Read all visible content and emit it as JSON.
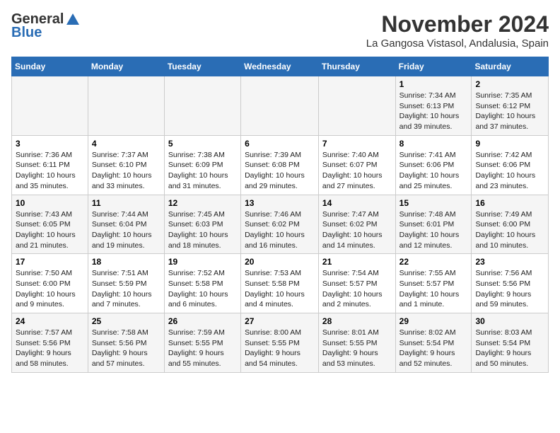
{
  "logo": {
    "general": "General",
    "blue": "Blue"
  },
  "title": "November 2024",
  "location": "La Gangosa Vistasol, Andalusia, Spain",
  "days_of_week": [
    "Sunday",
    "Monday",
    "Tuesday",
    "Wednesday",
    "Thursday",
    "Friday",
    "Saturday"
  ],
  "weeks": [
    [
      {
        "day": "",
        "info": ""
      },
      {
        "day": "",
        "info": ""
      },
      {
        "day": "",
        "info": ""
      },
      {
        "day": "",
        "info": ""
      },
      {
        "day": "",
        "info": ""
      },
      {
        "day": "1",
        "info": "Sunrise: 7:34 AM\nSunset: 6:13 PM\nDaylight: 10 hours and 39 minutes."
      },
      {
        "day": "2",
        "info": "Sunrise: 7:35 AM\nSunset: 6:12 PM\nDaylight: 10 hours and 37 minutes."
      }
    ],
    [
      {
        "day": "3",
        "info": "Sunrise: 7:36 AM\nSunset: 6:11 PM\nDaylight: 10 hours and 35 minutes."
      },
      {
        "day": "4",
        "info": "Sunrise: 7:37 AM\nSunset: 6:10 PM\nDaylight: 10 hours and 33 minutes."
      },
      {
        "day": "5",
        "info": "Sunrise: 7:38 AM\nSunset: 6:09 PM\nDaylight: 10 hours and 31 minutes."
      },
      {
        "day": "6",
        "info": "Sunrise: 7:39 AM\nSunset: 6:08 PM\nDaylight: 10 hours and 29 minutes."
      },
      {
        "day": "7",
        "info": "Sunrise: 7:40 AM\nSunset: 6:07 PM\nDaylight: 10 hours and 27 minutes."
      },
      {
        "day": "8",
        "info": "Sunrise: 7:41 AM\nSunset: 6:06 PM\nDaylight: 10 hours and 25 minutes."
      },
      {
        "day": "9",
        "info": "Sunrise: 7:42 AM\nSunset: 6:06 PM\nDaylight: 10 hours and 23 minutes."
      }
    ],
    [
      {
        "day": "10",
        "info": "Sunrise: 7:43 AM\nSunset: 6:05 PM\nDaylight: 10 hours and 21 minutes."
      },
      {
        "day": "11",
        "info": "Sunrise: 7:44 AM\nSunset: 6:04 PM\nDaylight: 10 hours and 19 minutes."
      },
      {
        "day": "12",
        "info": "Sunrise: 7:45 AM\nSunset: 6:03 PM\nDaylight: 10 hours and 18 minutes."
      },
      {
        "day": "13",
        "info": "Sunrise: 7:46 AM\nSunset: 6:02 PM\nDaylight: 10 hours and 16 minutes."
      },
      {
        "day": "14",
        "info": "Sunrise: 7:47 AM\nSunset: 6:02 PM\nDaylight: 10 hours and 14 minutes."
      },
      {
        "day": "15",
        "info": "Sunrise: 7:48 AM\nSunset: 6:01 PM\nDaylight: 10 hours and 12 minutes."
      },
      {
        "day": "16",
        "info": "Sunrise: 7:49 AM\nSunset: 6:00 PM\nDaylight: 10 hours and 10 minutes."
      }
    ],
    [
      {
        "day": "17",
        "info": "Sunrise: 7:50 AM\nSunset: 6:00 PM\nDaylight: 10 hours and 9 minutes."
      },
      {
        "day": "18",
        "info": "Sunrise: 7:51 AM\nSunset: 5:59 PM\nDaylight: 10 hours and 7 minutes."
      },
      {
        "day": "19",
        "info": "Sunrise: 7:52 AM\nSunset: 5:58 PM\nDaylight: 10 hours and 6 minutes."
      },
      {
        "day": "20",
        "info": "Sunrise: 7:53 AM\nSunset: 5:58 PM\nDaylight: 10 hours and 4 minutes."
      },
      {
        "day": "21",
        "info": "Sunrise: 7:54 AM\nSunset: 5:57 PM\nDaylight: 10 hours and 2 minutes."
      },
      {
        "day": "22",
        "info": "Sunrise: 7:55 AM\nSunset: 5:57 PM\nDaylight: 10 hours and 1 minute."
      },
      {
        "day": "23",
        "info": "Sunrise: 7:56 AM\nSunset: 5:56 PM\nDaylight: 9 hours and 59 minutes."
      }
    ],
    [
      {
        "day": "24",
        "info": "Sunrise: 7:57 AM\nSunset: 5:56 PM\nDaylight: 9 hours and 58 minutes."
      },
      {
        "day": "25",
        "info": "Sunrise: 7:58 AM\nSunset: 5:56 PM\nDaylight: 9 hours and 57 minutes."
      },
      {
        "day": "26",
        "info": "Sunrise: 7:59 AM\nSunset: 5:55 PM\nDaylight: 9 hours and 55 minutes."
      },
      {
        "day": "27",
        "info": "Sunrise: 8:00 AM\nSunset: 5:55 PM\nDaylight: 9 hours and 54 minutes."
      },
      {
        "day": "28",
        "info": "Sunrise: 8:01 AM\nSunset: 5:55 PM\nDaylight: 9 hours and 53 minutes."
      },
      {
        "day": "29",
        "info": "Sunrise: 8:02 AM\nSunset: 5:54 PM\nDaylight: 9 hours and 52 minutes."
      },
      {
        "day": "30",
        "info": "Sunrise: 8:03 AM\nSunset: 5:54 PM\nDaylight: 9 hours and 50 minutes."
      }
    ]
  ]
}
